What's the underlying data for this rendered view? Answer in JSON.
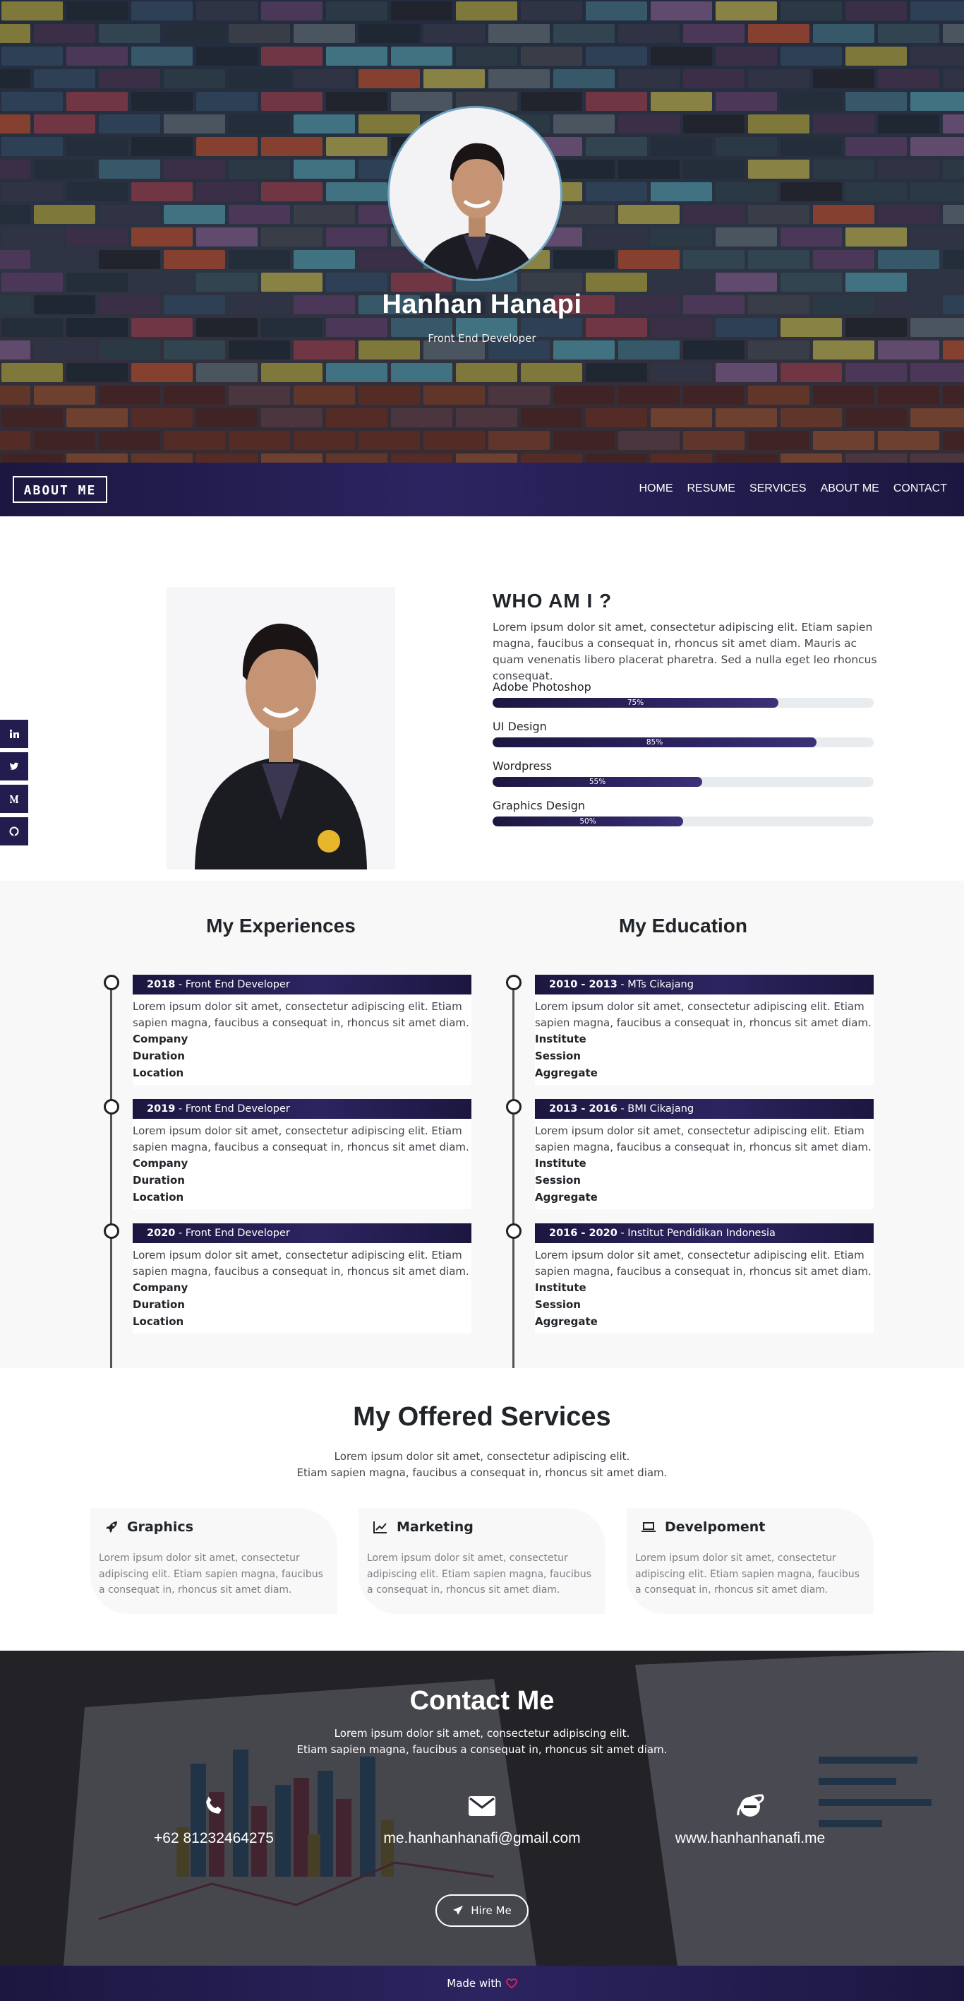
{
  "hero": {
    "name": "Hanhan Hanapi",
    "role": "Front End Developer"
  },
  "nav": {
    "logo_text": "ABOUT ME",
    "items": [
      "HOME",
      "RESUME",
      "SERVICES",
      "ABOUT ME",
      "CONTACT"
    ]
  },
  "social": {
    "icons": [
      "linkedin-icon",
      "twitter-icon",
      "medium-icon",
      "github-icon"
    ]
  },
  "about": {
    "title": "WHO AM I ?",
    "text": "Lorem ipsum dolor sit amet, consectetur adipiscing elit. Etiam sapien magna, faucibus a consequat in, rhoncus sit amet diam. Mauris ac quam venenatis libero placerat pharetra. Sed a nulla eget leo rhoncus consequat.",
    "skills": [
      {
        "name": "Adobe Photoshop",
        "percent": 75,
        "label": "75%"
      },
      {
        "name": "UI Design",
        "percent": 85,
        "label": "85%"
      },
      {
        "name": "Wordpress",
        "percent": 55,
        "label": "55%"
      },
      {
        "name": "Graphics Design",
        "percent": 50,
        "label": "50%"
      }
    ]
  },
  "experiences": {
    "title": "My Experiences",
    "items": [
      {
        "year": "2018",
        "title": " - Front End Developer",
        "text": "Lorem ipsum dolor sit amet, consectetur adipiscing elit. Etiam sapien magna, faucibus a consequat in, rhoncus sit amet diam.",
        "f1": "Company",
        "f2": "Duration",
        "f3": "Location"
      },
      {
        "year": "2019",
        "title": " - Front End Developer",
        "text": "Lorem ipsum dolor sit amet, consectetur adipiscing elit. Etiam sapien magna, faucibus a consequat in, rhoncus sit amet diam.",
        "f1": "Company",
        "f2": "Duration",
        "f3": "Location"
      },
      {
        "year": "2020",
        "title": " - Front End Developer",
        "text": "Lorem ipsum dolor sit amet, consectetur adipiscing elit. Etiam sapien magna, faucibus a consequat in, rhoncus sit amet diam.",
        "f1": "Company",
        "f2": "Duration",
        "f3": "Location"
      }
    ]
  },
  "education": {
    "title": "My Education",
    "items": [
      {
        "year": "2010 - 2013",
        "title": " - MTs Cikajang",
        "text": "Lorem ipsum dolor sit amet, consectetur adipiscing elit. Etiam sapien magna, faucibus a consequat in, rhoncus sit amet diam.",
        "f1": "Institute",
        "f2": "Session",
        "f3": "Aggregate"
      },
      {
        "year": "2013 - 2016",
        "title": " - BMI Cikajang",
        "text": "Lorem ipsum dolor sit amet, consectetur adipiscing elit. Etiam sapien magna, faucibus a consequat in, rhoncus sit amet diam.",
        "f1": "Institute",
        "f2": "Session",
        "f3": "Aggregate"
      },
      {
        "year": "2016 - 2020",
        "title": " - Institut Pendidikan Indonesia",
        "text": "Lorem ipsum dolor sit amet, consectetur adipiscing elit. Etiam sapien magna, faucibus a consequat in, rhoncus sit amet diam.",
        "f1": "Institute",
        "f2": "Session",
        "f3": "Aggregate"
      }
    ]
  },
  "services": {
    "title": "My Offered Services",
    "sub1": "Lorem ipsum dolor sit amet, consectetur adipiscing elit.",
    "sub2": "Etiam sapien magna, faucibus a consequat in, rhoncus sit amet diam.",
    "items": [
      {
        "name": "Graphics",
        "icon": "rocket-icon",
        "text": "Lorem ipsum dolor sit amet, consectetur adipiscing elit. Etiam sapien magna, faucibus a consequat in, rhoncus sit amet diam."
      },
      {
        "name": "Marketing",
        "icon": "line-chart-icon",
        "text": "Lorem ipsum dolor sit amet, consectetur adipiscing elit. Etiam sapien magna, faucibus a consequat in, rhoncus sit amet diam."
      },
      {
        "name": "Develpoment",
        "icon": "laptop-icon",
        "text": "Lorem ipsum dolor sit amet, consectetur adipiscing elit. Etiam sapien magna, faucibus a consequat in, rhoncus sit amet diam."
      }
    ]
  },
  "contact": {
    "title": "Contact Me",
    "sub1": "Lorem ipsum dolor sit amet, consectetur adipiscing elit.",
    "sub2": "Etiam sapien magna, faucibus a consequat in, rhoncus sit amet diam.",
    "phone": "+62 81232464275",
    "email": "me.hanhanhanafi@gmail.com",
    "website": "www.hanhanhanafi.me",
    "hire_label": "Hire Me"
  },
  "footer": {
    "text": "Made with"
  },
  "colors": {
    "primary": "#231d4f",
    "accent": "#2c2460",
    "heart": "#e0245e"
  }
}
